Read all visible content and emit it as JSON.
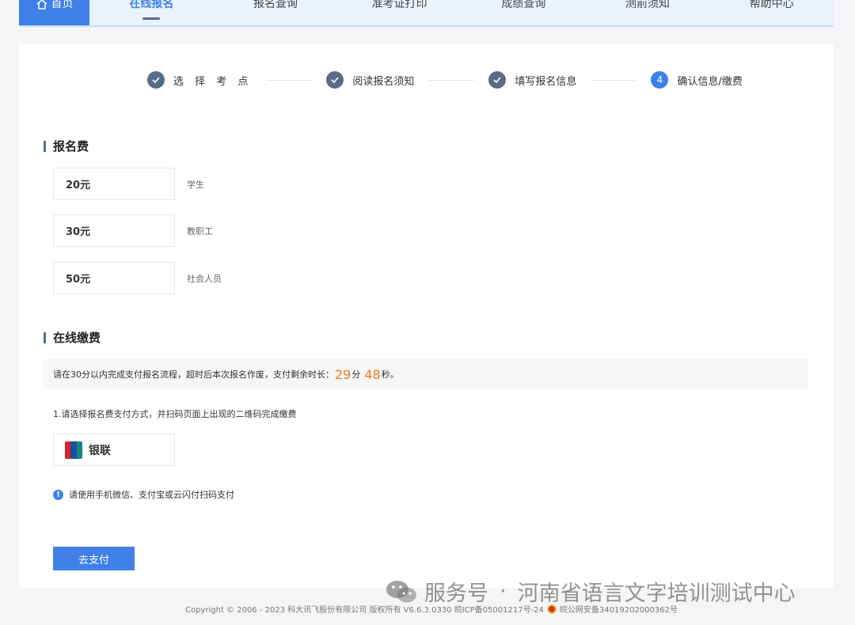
{
  "nav": {
    "items": [
      {
        "label": "首页"
      },
      {
        "label": "在线报名"
      },
      {
        "label": "报名查询"
      },
      {
        "label": "准考证打印"
      },
      {
        "label": "成绩查询"
      },
      {
        "label": "测前须知"
      },
      {
        "label": "帮助中心"
      }
    ],
    "active_index": 1
  },
  "steps": [
    {
      "label": "选 择 考 点",
      "state": "done"
    },
    {
      "label": "阅读报名须知",
      "state": "done"
    },
    {
      "label": "填写报名信息",
      "state": "done"
    },
    {
      "label": "确认信息/缴费",
      "state": "current",
      "number": "4"
    }
  ],
  "fee_section": {
    "title": "报名费",
    "rows": [
      {
        "amount": "20元",
        "desc": "学生"
      },
      {
        "amount": "30元",
        "desc": "教职工"
      },
      {
        "amount": "50元",
        "desc": "社会人员"
      }
    ]
  },
  "payment_section": {
    "title": "在线缴费",
    "notice_prefix": "请在30分以内完成支付报名流程，超时后本次报名作废，支付剩余时长：",
    "minutes": "29",
    "minutes_unit": "分",
    "seconds": "48",
    "seconds_unit": "秒。",
    "instruction": "1.请选择报名费支付方式，并扫码页面上出现的二维码完成缴费",
    "option_label": "银联",
    "hint": "请使用手机微信、支付宝或云闪付扫码支付",
    "pay_button": "去支付"
  },
  "footer": {
    "copyright": "Copyright © 2006 - 2023 科大讯飞股份有限公司 版权所有 V6.6.3.0330  皖ICP备05001217号-24",
    "police": "皖公网安备34019202000362号"
  },
  "watermark": {
    "prefix": "服务号",
    "separator": "·",
    "name": "河南省语言文字培训测试中心"
  },
  "colors": {
    "primary": "#3f80e8",
    "step_done": "#5a6a89",
    "countdown": "#f07a1a"
  }
}
